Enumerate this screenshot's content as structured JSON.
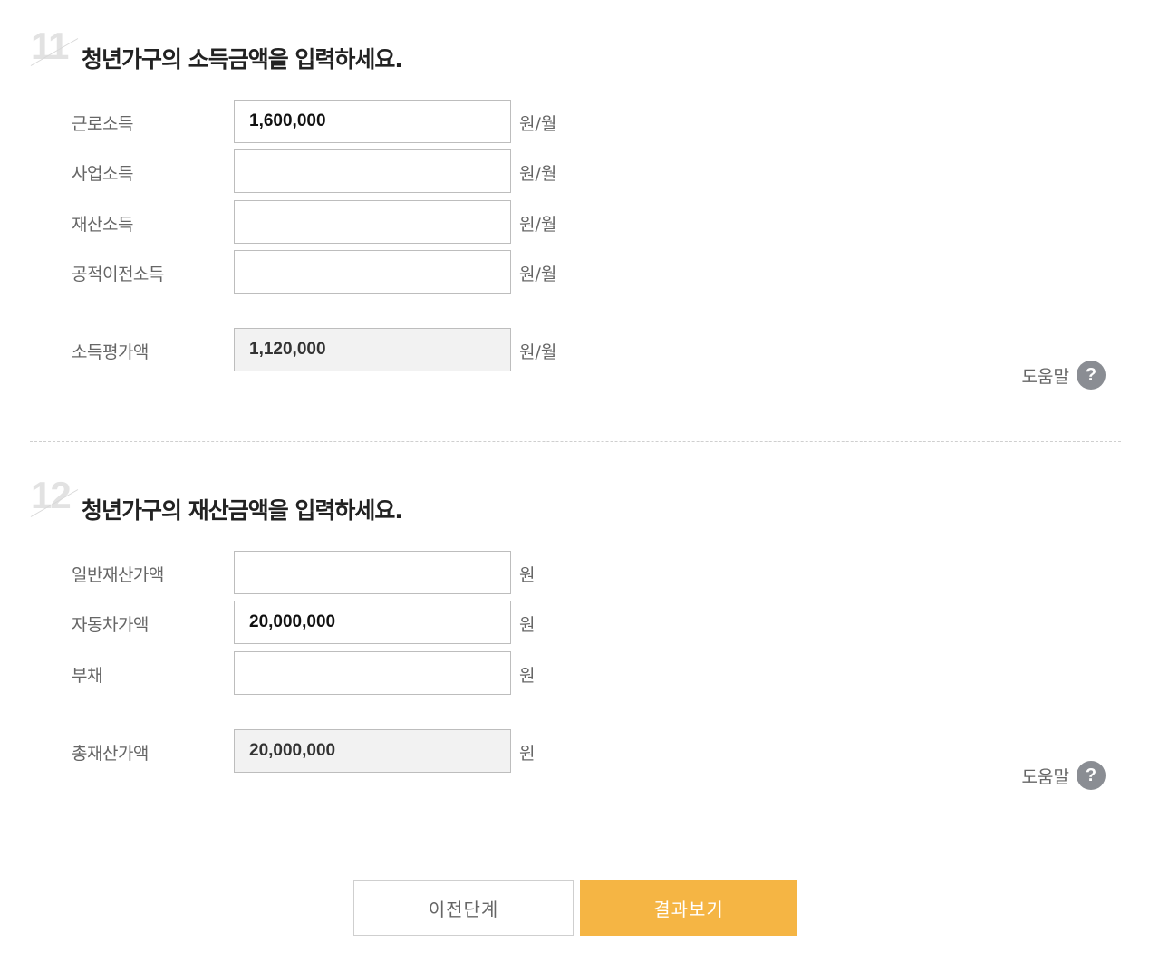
{
  "income_section": {
    "step_number": "11",
    "title": "청년가구의 소득금액을 입력하세요.",
    "rows": [
      {
        "label": "근로소득",
        "value": "1,600,000",
        "unit": "원/월"
      },
      {
        "label": "사업소득",
        "value": "",
        "unit": "원/월"
      },
      {
        "label": "재산소득",
        "value": "",
        "unit": "원/월"
      },
      {
        "label": "공적이전소득",
        "value": "",
        "unit": "원/월"
      }
    ],
    "total": {
      "label": "소득평가액",
      "value": "1,120,000",
      "unit": "원/월"
    },
    "help_label": "도움말"
  },
  "asset_section": {
    "step_number": "12",
    "title": "청년가구의 재산금액을 입력하세요.",
    "rows": [
      {
        "label": "일반재산가액",
        "value": "",
        "unit": "원"
      },
      {
        "label": "자동차가액",
        "value": "20,000,000",
        "unit": "원"
      },
      {
        "label": "부채",
        "value": "",
        "unit": "원"
      }
    ],
    "total": {
      "label": "총재산가액",
      "value": "20,000,000",
      "unit": "원"
    },
    "help_label": "도움말"
  },
  "buttons": {
    "prev_label": "이전단계",
    "result_label": "결과보기"
  },
  "help_icon_glyph": "?",
  "colors": {
    "accent": "#f5b544",
    "help_icon": "#8a8d93",
    "readonly_bg": "#f2f2f2"
  }
}
